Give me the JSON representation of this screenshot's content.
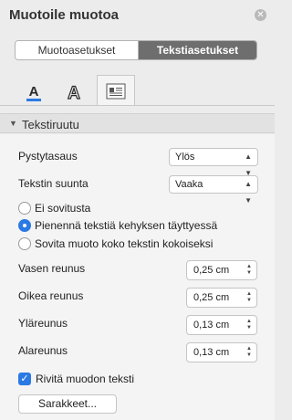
{
  "pane": {
    "title": "Muotoile muotoa",
    "close_icon": "close-icon"
  },
  "segmented": {
    "items": [
      "Muotoasetukset",
      "Tekstiasetukset"
    ],
    "selected": "Tekstiasetukset"
  },
  "tabs": [
    {
      "icon": "text-fill-icon"
    },
    {
      "icon": "text-outline-icon"
    },
    {
      "icon": "text-box-layout-icon",
      "active": true
    }
  ],
  "section": {
    "label": "Tekstiruutu",
    "expanded": true
  },
  "fields": {
    "vertical_align": {
      "label": "Pystytasaus",
      "value": "Ylös"
    },
    "text_direction": {
      "label": "Tekstin suunta",
      "value": "Vaaka"
    }
  },
  "autofit": {
    "options": [
      "Ei sovitusta",
      "Pienennä tekstiä kehyksen täyttyessä",
      "Sovita muoto koko tekstin kokoiseksi"
    ],
    "selected": "Pienennä tekstiä kehyksen täyttyessä"
  },
  "margins": {
    "left": {
      "label": "Vasen reunus",
      "value": "0,25 cm"
    },
    "right": {
      "label": "Oikea reunus",
      "value": "0,25 cm"
    },
    "top": {
      "label": "Yläreunus",
      "value": "0,13 cm"
    },
    "bottom": {
      "label": "Alareunus",
      "value": "0,13 cm"
    }
  },
  "wrap": {
    "label": "Rivitä muodon teksti",
    "checked": true
  },
  "columns_button": "Sarakkeet...",
  "colors": {
    "accent": "#2b7ae4",
    "selected_segment": "#6e6e6e"
  }
}
